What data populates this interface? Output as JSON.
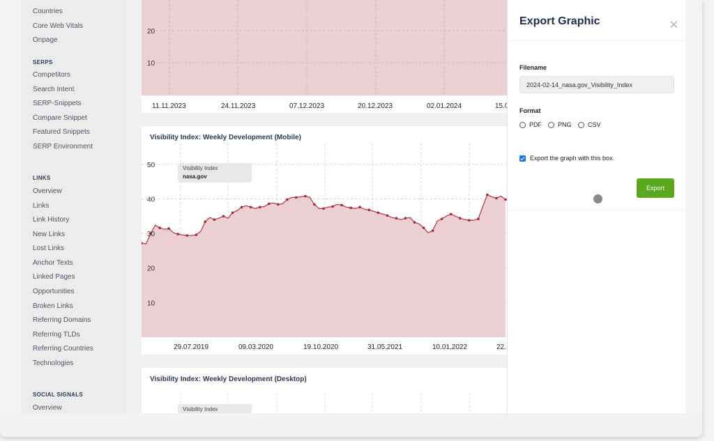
{
  "sidebar": {
    "sections": [
      {
        "heading": "",
        "items": [
          "Countries",
          "Core Web Vitals",
          "Onpage"
        ]
      },
      {
        "heading": "SERPS",
        "items": [
          "Competitors",
          "Search Intent",
          "SERP-Snippets",
          "Compare Snippet",
          "Featured Snippets",
          "SERP Environment"
        ]
      },
      {
        "heading": "LINKS",
        "items": [
          "Overview",
          "Links",
          "Link History",
          "New Links",
          "Lost Links",
          "Anchor Texts",
          "Linked Pages",
          "Opportunities",
          "Broken Links",
          "Referring Domains",
          "Referring TLDs",
          "Referring Countries",
          "Technologies"
        ]
      },
      {
        "heading": "SOCIAL SIGNALS",
        "items": [
          "Overview"
        ]
      }
    ]
  },
  "colors": {
    "area_fill": "#eccfd3",
    "line": "#b4404f",
    "point": "#a8283c",
    "export_button": "#5aa81e"
  },
  "chart_data": [
    {
      "type": "area",
      "title": "",
      "y_ticks": [
        "20",
        "10"
      ],
      "x_tick_labels": [
        "11.11.2023",
        "24.11.2023",
        "07.12.2023",
        "20.12.2023",
        "02.01.2024",
        "15.0"
      ],
      "grid": true
    },
    {
      "type": "area",
      "title": "Visibility Index: Weekly Development (Mobile)",
      "legend": {
        "label": "Visibility Index",
        "series": "nasa.gov"
      },
      "y_ticks": [
        "50",
        "40",
        "30",
        "20",
        "10"
      ],
      "ylim": [
        0,
        56
      ],
      "x_tick_labels": [
        "29.07.2019",
        "09.03.2020",
        "19.10.2020",
        "31.05.2021",
        "10.01.2022",
        "22."
      ],
      "grid": true,
      "series": [
        {
          "name": "nasa.gov",
          "values": [
            27.2,
            27,
            30,
            32.4,
            31.6,
            31.2,
            31.4,
            30.2,
            29.8,
            29.6,
            29.4,
            29.4,
            29.6,
            30.6,
            33.4,
            34.6,
            34,
            34.4,
            35,
            34.4,
            36,
            36.6,
            37.6,
            38,
            37.6,
            37.2,
            37.6,
            37.8,
            38.6,
            38.8,
            38.4,
            38.6,
            39.8,
            40.4,
            40.4,
            40.6,
            40.8,
            40.4,
            38.4,
            37.2,
            37.2,
            37.6,
            37.8,
            38.4,
            38.2,
            37.6,
            37.4,
            37.2,
            37.6,
            37,
            36.8,
            36.4,
            36,
            35.6,
            35.2,
            34.6,
            34.4,
            34,
            34.4,
            34.6,
            33.2,
            32.8,
            31.6,
            30.2,
            30.8,
            33.6,
            34.2,
            35,
            35.6,
            35,
            34.4,
            34,
            33.8,
            33.8,
            34.2,
            37.8,
            41.2,
            40.6,
            40.2,
            40.8,
            39.8
          ]
        }
      ]
    },
    {
      "type": "area",
      "title": "Visibility Index: Weekly Development (Desktop)",
      "legend": {
        "label": "Visibility Index",
        "series": ""
      }
    }
  ],
  "export_panel": {
    "title": "Export Graphic",
    "close_icon": "close-icon",
    "filename_label": "Filename",
    "filename_value": "2024-02-14_nasa.gov_Visibility_Index",
    "format_label": "Format",
    "formats": [
      "PDF",
      "PNG",
      "CSV"
    ],
    "checkbox_label": "Export the graph with this box.",
    "checkbox_checked": true,
    "export_button": "Export"
  }
}
